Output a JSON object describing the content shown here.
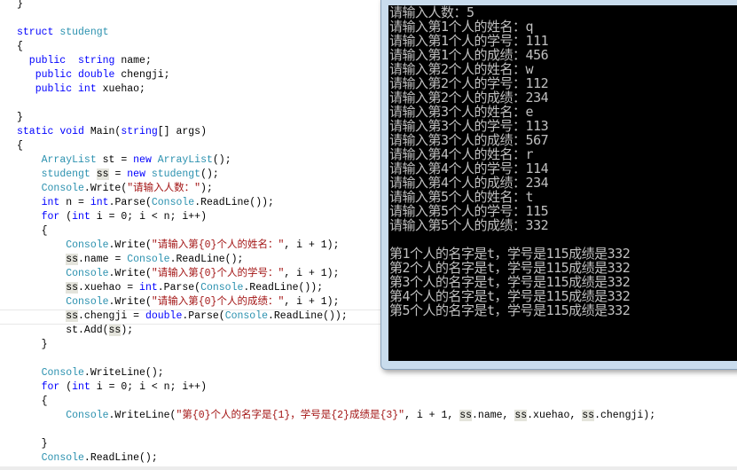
{
  "editor": {
    "lines": [
      [
        [
          "}",
          ""
        ]
      ],
      [],
      [
        [
          "struct ",
          "kw"
        ],
        [
          "studengt",
          "ty"
        ]
      ],
      [
        [
          "{",
          ""
        ]
      ],
      [
        [
          "  public  ",
          "kw"
        ],
        [
          "string",
          "kw"
        ],
        [
          " name;",
          ""
        ]
      ],
      [
        [
          "   public ",
          "kw"
        ],
        [
          "double",
          "kw"
        ],
        [
          " chengji;",
          ""
        ]
      ],
      [
        [
          "   public ",
          "kw"
        ],
        [
          "int",
          "kw"
        ],
        [
          " xuehao;",
          ""
        ]
      ],
      [],
      [
        [
          "}",
          ""
        ]
      ],
      [
        [
          "static ",
          "kw"
        ],
        [
          "void",
          "kw"
        ],
        [
          " Main(",
          ""
        ],
        [
          "string",
          "kw"
        ],
        [
          "[] args)",
          ""
        ]
      ],
      [
        [
          "{",
          ""
        ]
      ],
      [
        [
          "    ",
          ""
        ],
        [
          "ArrayList",
          "ty"
        ],
        [
          " st = ",
          ""
        ],
        [
          "new ",
          "kw"
        ],
        [
          "ArrayList",
          "ty"
        ],
        [
          "();",
          ""
        ]
      ],
      [
        [
          "    ",
          ""
        ],
        [
          "studengt",
          "ty"
        ],
        [
          " ",
          ""
        ],
        [
          "ss",
          "hl"
        ],
        [
          " = ",
          ""
        ],
        [
          "new ",
          "kw"
        ],
        [
          "studengt",
          "ty"
        ],
        [
          "();",
          ""
        ]
      ],
      [
        [
          "    ",
          ""
        ],
        [
          "Console",
          "ty"
        ],
        [
          ".Write(",
          ""
        ],
        [
          "\"请输入人数：\"",
          "st"
        ],
        [
          ");",
          ""
        ]
      ],
      [
        [
          "    ",
          ""
        ],
        [
          "int",
          "kw"
        ],
        [
          " n = ",
          ""
        ],
        [
          "int",
          "kw"
        ],
        [
          ".Parse(",
          ""
        ],
        [
          "Console",
          "ty"
        ],
        [
          ".ReadLine());",
          ""
        ]
      ],
      [
        [
          "    ",
          ""
        ],
        [
          "for",
          "kw"
        ],
        [
          " (",
          ""
        ],
        [
          "int",
          "kw"
        ],
        [
          " i = 0; i < n; i++)",
          ""
        ]
      ],
      [
        [
          "    {",
          ""
        ]
      ],
      [
        [
          "        ",
          ""
        ],
        [
          "Console",
          "ty"
        ],
        [
          ".Write(",
          ""
        ],
        [
          "\"请输入第{0}个人的姓名：\"",
          "st"
        ],
        [
          ", i + 1);",
          ""
        ]
      ],
      [
        [
          "        ",
          ""
        ],
        [
          "ss",
          "hl"
        ],
        [
          ".name = ",
          ""
        ],
        [
          "Console",
          "ty"
        ],
        [
          ".ReadLine();",
          ""
        ]
      ],
      [
        [
          "        ",
          ""
        ],
        [
          "Console",
          "ty"
        ],
        [
          ".Write(",
          ""
        ],
        [
          "\"请输入第{0}个人的学号：\"",
          "st"
        ],
        [
          ", i + 1);",
          ""
        ]
      ],
      [
        [
          "        ",
          ""
        ],
        [
          "ss",
          "hl"
        ],
        [
          ".xuehao = ",
          ""
        ],
        [
          "int",
          "kw"
        ],
        [
          ".Parse(",
          ""
        ],
        [
          "Console",
          "ty"
        ],
        [
          ".ReadLine());",
          ""
        ]
      ],
      [
        [
          "        ",
          ""
        ],
        [
          "Console",
          "ty"
        ],
        [
          ".Write(",
          ""
        ],
        [
          "\"请输入第{0}个人的成绩：\"",
          "st"
        ],
        [
          ", i + 1);",
          ""
        ]
      ],
      [
        [
          "        ",
          ""
        ],
        [
          "ss",
          "hl"
        ],
        [
          ".chengji = ",
          ""
        ],
        [
          "double",
          "kw"
        ],
        [
          ".Parse(",
          ""
        ],
        [
          "Console",
          "ty"
        ],
        [
          ".ReadLine());",
          ""
        ]
      ],
      [
        [
          "        st.Add(",
          ""
        ],
        [
          "ss",
          "hl"
        ],
        [
          ");",
          ""
        ]
      ],
      [
        [
          "    }",
          ""
        ]
      ],
      [],
      [
        [
          "    ",
          ""
        ],
        [
          "Console",
          "ty"
        ],
        [
          ".WriteLine();",
          ""
        ]
      ],
      [
        [
          "    ",
          ""
        ],
        [
          "for",
          "kw"
        ],
        [
          " (",
          ""
        ],
        [
          "int",
          "kw"
        ],
        [
          " i = 0; i < n; i++)",
          ""
        ]
      ],
      [
        [
          "    {",
          ""
        ]
      ],
      [
        [
          "        ",
          ""
        ],
        [
          "Console",
          "ty"
        ],
        [
          ".WriteLine(",
          ""
        ],
        [
          "\"第{0}个人的名字是{1}，学号是{2}成绩是{3}\"",
          "st"
        ],
        [
          ", i + 1, ",
          ""
        ],
        [
          "ss",
          "hl"
        ],
        [
          ".name, ",
          ""
        ],
        [
          "ss",
          "hl"
        ],
        [
          ".xuehao, ",
          ""
        ],
        [
          "ss",
          "hl"
        ],
        [
          ".chengji);",
          ""
        ]
      ],
      [],
      [
        [
          "    }",
          ""
        ]
      ],
      [
        [
          "    ",
          ""
        ],
        [
          "Console",
          "ty"
        ],
        [
          ".ReadLine();",
          ""
        ]
      ]
    ]
  },
  "console": {
    "lines": [
      "请输入人数：5",
      "请输入第1个人的姓名：q",
      "请输入第1个人的学号：111",
      "请输入第1个人的成绩：456",
      "请输入第2个人的姓名：w",
      "请输入第2个人的学号：112",
      "请输入第2个人的成绩：234",
      "请输入第3个人的姓名：e",
      "请输入第3个人的学号：113",
      "请输入第3个人的成绩：567",
      "请输入第4个人的姓名：r",
      "请输入第4个人的学号：114",
      "请输入第4个人的成绩：234",
      "请输入第5个人的姓名：t",
      "请输入第5个人的学号：115",
      "请输入第5个人的成绩：332",
      "",
      "第1个人的名字是t，学号是115成绩是332",
      "第2个人的名字是t，学号是115成绩是332",
      "第3个人的名字是t，学号是115成绩是332",
      "第4个人的名字是t，学号是115成绩是332",
      "第5个人的名字是t，学号是115成绩是332"
    ]
  },
  "colors": {
    "keyword": "#0000ff",
    "type": "#2b91af",
    "string": "#a31515",
    "console_bg": "#000000",
    "console_text": "#c0c0c0"
  }
}
